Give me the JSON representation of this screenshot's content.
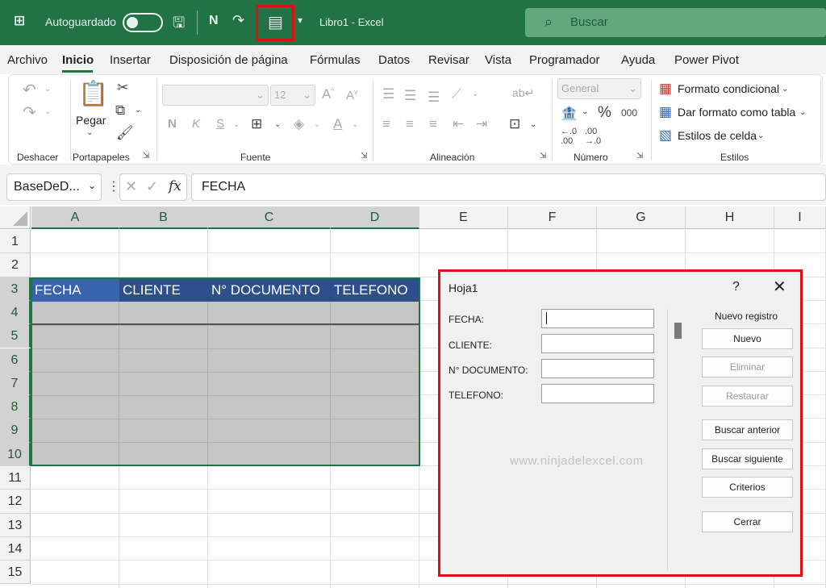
{
  "titlebar": {
    "autosave": "Autoguardado",
    "filename": "Libro1",
    "sep": "-",
    "app": "Excel",
    "search_placeholder": "Buscar",
    "bold_letter": "N"
  },
  "menu": {
    "tabs": [
      "Archivo",
      "Inicio",
      "Insertar",
      "Disposición de página",
      "Fórmulas",
      "Datos",
      "Revisar",
      "Vista",
      "Programador",
      "Ayuda",
      "Power Pivot"
    ],
    "active": "Inicio"
  },
  "ribbon": {
    "groups": {
      "undo": "Deshacer",
      "clipboard": "Portapapeles",
      "font": "Fuente",
      "alignment": "Alineación",
      "number": "Número",
      "styles": "Estilos"
    },
    "paste_label": "Pegar",
    "font_size": "12",
    "number_format": "General",
    "percent": "%",
    "thousands": "000",
    "bold": "N",
    "italic": "K",
    "underline": "S",
    "fx": "fx",
    "styles_items": [
      "Formato condicional",
      "Dar formato como tabla",
      "Estilos de celda"
    ]
  },
  "formula_bar": {
    "name_box": "BaseDeD...",
    "formula": "FECHA"
  },
  "sheet": {
    "columns": [
      "A",
      "B",
      "C",
      "D",
      "E",
      "F",
      "G",
      "H",
      "I"
    ],
    "rows": [
      "1",
      "2",
      "3",
      "4",
      "5",
      "6",
      "7",
      "8",
      "9",
      "10",
      "11",
      "12",
      "13",
      "14",
      "15"
    ],
    "headers": [
      "FECHA",
      "CLIENTE",
      "N° DOCUMENTO",
      "TELEFONO"
    ]
  },
  "dialog": {
    "title": "Hoja1",
    "help": "?",
    "close": "✕",
    "fields": [
      {
        "label": "FECHA:",
        "value": ""
      },
      {
        "label": "CLIENTE:",
        "value": ""
      },
      {
        "label": "N° DOCUMENTO:",
        "value": ""
      },
      {
        "label": "TELEFONO:",
        "value": ""
      }
    ],
    "record_status": "Nuevo registro",
    "buttons": [
      "Nuevo",
      "Eliminar",
      "Restaurar",
      "Buscar anterior",
      "Buscar siguiente",
      "Criterios",
      "Cerrar"
    ],
    "disabled_buttons": [
      "Eliminar",
      "Restaurar"
    ],
    "watermark": "www.ninjadelexcel.com"
  },
  "colors": {
    "excel_green": "#217346",
    "header_fill": "#2e4f8a",
    "highlight_red": "#e01010"
  },
  "icons": [
    "excel-logo-icon",
    "save-icon",
    "redo-icon",
    "form-icon",
    "search-icon",
    "undo-icon",
    "paste-icon",
    "cut-icon",
    "copy-icon",
    "format-painter-icon",
    "arrow-annotation-icon"
  ]
}
